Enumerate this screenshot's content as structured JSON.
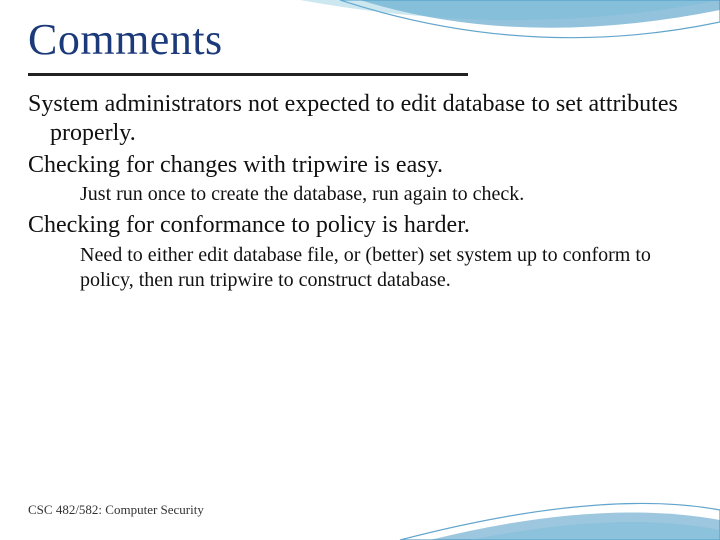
{
  "title": "Comments",
  "lines": {
    "p1": "System administrators not expected to edit database to set attributes properly.",
    "p2": "Checking for changes with tripwire is easy.",
    "p2a": "Just run once to create the database, run again to check.",
    "p3": "Checking for conformance to policy is harder.",
    "p3a": "Need to either edit database file, or (better) set system up to conform to policy, then run tripwire to construct database."
  },
  "footer": "CSC 482/582: Computer Security"
}
